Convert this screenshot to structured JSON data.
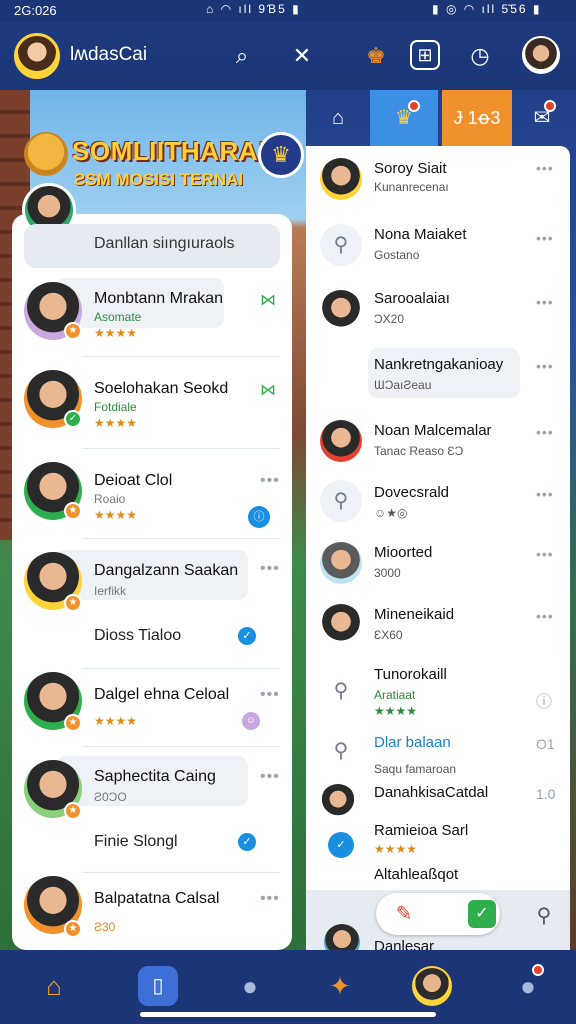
{
  "status_bar": {
    "time": "2G:026",
    "mid_icons": "⌂ ◠ ıll 9Ɓ5 ▮",
    "right_icons": "▮ ◎ ◠ ıll 5̃56 ▮"
  },
  "header": {
    "title": "lʍdasCai",
    "search_icon": "⌕",
    "close_icon": "✕",
    "grid_icon": "⊞",
    "timer_icon": "◷"
  },
  "promo": {
    "title": "SOMLIITHARA!",
    "subtitle": "ƧSM MOSISI TERNAI"
  },
  "left_list": {
    "search_label": "Danllan siıngıuraols",
    "items": [
      {
        "name": "Monbtann Mrakan",
        "sub": "Asomate",
        "stars": "★★★★"
      },
      {
        "name": "Soelohakan Seokd",
        "sub": "Fotdiale",
        "stars": "★★★★"
      },
      {
        "name": "Deioat Clol",
        "sub": "Roaio",
        "stars": "★★★★"
      },
      {
        "name": "Dangalzann Saakan",
        "sub": "Ierfikk"
      },
      {
        "name": "Dioss Tialoo"
      },
      {
        "name": "Dalgel ehna Celoal",
        "stars": "★★★★"
      },
      {
        "name": "Saphectita Caing",
        "sub": "Ƨ0ƆO"
      },
      {
        "name": "Finie Slongl"
      },
      {
        "name": "Balpatatna Calsal",
        "sub": "Ƨ30"
      }
    ]
  },
  "tabs": {
    "home": "⌂",
    "trophy": "♛",
    "orange_label": "Ɉ 1ꝋ3",
    "message": "✉"
  },
  "right_list": {
    "items": [
      {
        "name": "Soroy Siait",
        "sub": "Kunanrecenaı"
      },
      {
        "name": "Nona Maiaket",
        "sub": "Gostano"
      },
      {
        "name": "Sarooalaiaı",
        "sub": "ƆX20"
      },
      {
        "name": "Nankretngakanioay",
        "sub": "ƜƆaıƧeau"
      },
      {
        "name": "Noan Malcemalar",
        "sub": "Tanac Reaso ƐƆ"
      },
      {
        "name": "Dovecsrald",
        "sub": ""
      },
      {
        "name": "Mioorted",
        "sub": "3000"
      },
      {
        "name": "Mineneikaid",
        "sub": "ƐX60"
      },
      {
        "name": "Tunorokaill",
        "sub": "Aratiaat"
      },
      {
        "name": "Dlar balaan",
        "sub": "Saqu famaroan",
        "side": "O1"
      },
      {
        "name": "DanahkisaCatdal",
        "sub": "Ramieioa Sarl",
        "side": "1.0"
      },
      {
        "name": "Altahleaßqot"
      }
    ],
    "bottom_peek": "Danlesar"
  },
  "bottom_nav": {
    "home": "⌂",
    "phone": "▯",
    "contacts": "●",
    "game": "✦",
    "profile": "●"
  }
}
